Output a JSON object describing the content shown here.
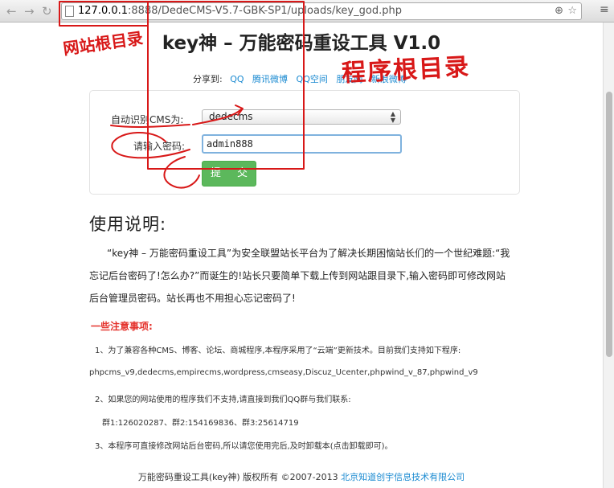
{
  "browser": {
    "back_icon": "arrow-left-icon",
    "forward_icon": "arrow-right-icon",
    "reload_icon": "reload-icon",
    "url_host": "127.0.0.1",
    "url_port": ":8888",
    "url_path": "/DedeCMS-V5.7-GBK-SP1/uploads/key_god.php",
    "zoom_icon": "magnifier-icon",
    "star_icon": "star-icon",
    "menu_icon": "menu-icon"
  },
  "page": {
    "title": "key神 – 万能密码重设工具 V1.0",
    "share": {
      "label": "分享到:",
      "links": [
        "QQ",
        "腾讯微博",
        "QQ空间",
        "朋友网",
        "新浪微博"
      ]
    },
    "form": {
      "cms_label": "自动识别CMS为:",
      "cms_value": "dedecms",
      "password_label": "请输入密码:",
      "password_value": "admin888",
      "submit_label": "提 交"
    },
    "usage_heading": "使用说明:",
    "intro_text": "“key神 – 万能密码重设工具”为安全联盟站长平台为了解决长期困恼站长们的一个世纪难题:“我忘记后台密码了!怎么办?”而诞生的!站长只要简单下载上传到网站跟目录下,输入密码即可修改网站后台管理员密码。站长再也不用担心忘记密码了!",
    "notice_heading": "一些注意事项:",
    "item1": "1、为了兼容各种CMS、博客、论坛、商城程序,本程序采用了“云端”更新技术。目前我们支持如下程序:",
    "cms_list": "phpcms_v9,dedecms,empirecms,wordpress,cmseasy,Discuz_Ucenter,phpwind_v_87,phpwind_v9",
    "item2": "2、如果您的网站使用的程序我们不支持,请直接到我们QQ群与我们联系:",
    "groups": "群1:126020287、群2:154169836、群3:25614719",
    "item3": "3、本程序可直接修改网站后台密码,所以请您使用完后,及时卸载本(点击卸载即可)。",
    "footer_text": "万能密码重设工具(key神)  版权所有 ©2007-2013 ",
    "footer_company": "北京知道创宇信息技术有限公司"
  },
  "annotations": {
    "web_root": "网站根目录",
    "program_root": "程序根目录",
    "color": "#d81818"
  }
}
